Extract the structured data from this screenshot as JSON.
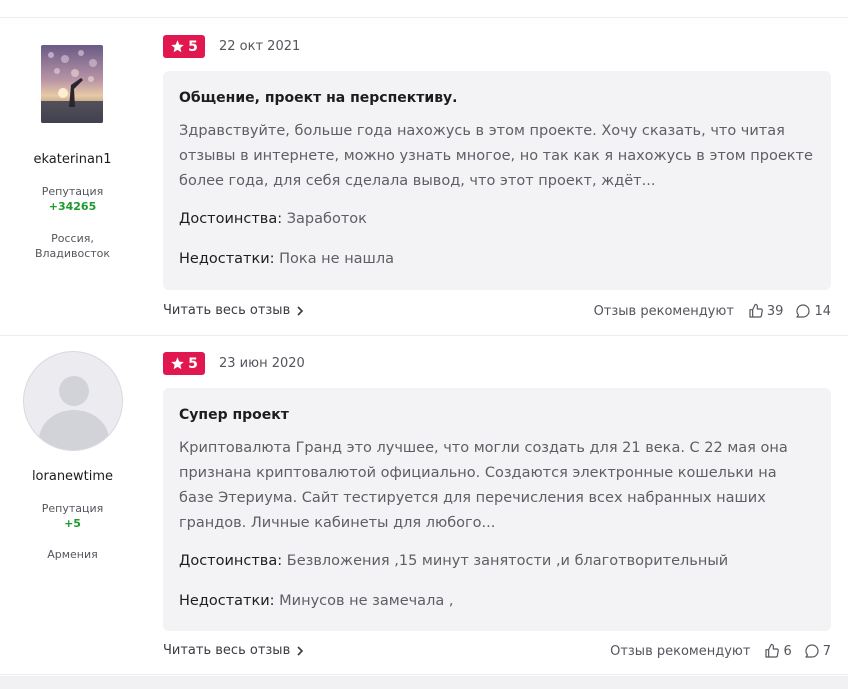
{
  "reviews": [
    {
      "username": "ekaterinan1",
      "reputation_label": "Репутация",
      "reputation_value": "+34265",
      "location_line1": "Россия,",
      "location_line2": "Владивосток",
      "rating": "5",
      "date": "22 окт 2021",
      "title": "Общение, проект на перспективу.",
      "text": "Здравствуйте, больше года нахожусь в этом проекте. Хочу сказать, что читая отзывы в интернете, можно узнать многое, но так как я нахожусь в этом проекте более года, для себя сделала вывод, что этот проект, ждёт...",
      "pros_label": "Достоинства:",
      "pros": "Заработок",
      "cons_label": "Недостатки:",
      "cons": "Пока не нашла",
      "read_more": "Читать весь отзыв",
      "recommend_label": "Отзыв рекомендуют",
      "likes": "39",
      "comments": "14"
    },
    {
      "username": "loranewtime",
      "reputation_label": "Репутация",
      "reputation_value": "+5",
      "location_line1": "Армения",
      "rating": "5",
      "date": "23 июн 2020",
      "title": "Супер проект",
      "text": "Криптовалюта Гранд это лучшее, что могли создать для 21 века. С 22 мая она признана криптовалютой официально. Создаются электронные кошельки на базе Этериума. Сайт тестируется для перечисления всех набранных наших грандов. Личные кабинеты для любого...",
      "pros_label": "Достоинства:",
      "pros": "Безвложения ,15 минут занятости ,и благотворительный",
      "cons_label": "Недостатки:",
      "cons": "Минусов не замечала ,",
      "read_more": "Читать весь отзыв",
      "recommend_label": "Отзыв рекомендуют",
      "likes": "6",
      "comments": "7"
    }
  ],
  "colors": {
    "badge": "#e0184f",
    "reputation": "#1f9a2d",
    "bubble": "#f3f3f5"
  },
  "icons": {
    "rating": "star-icon",
    "read_more": "chevron-right-icon",
    "likes": "thumbs-up-icon",
    "comments": "comment-icon"
  }
}
